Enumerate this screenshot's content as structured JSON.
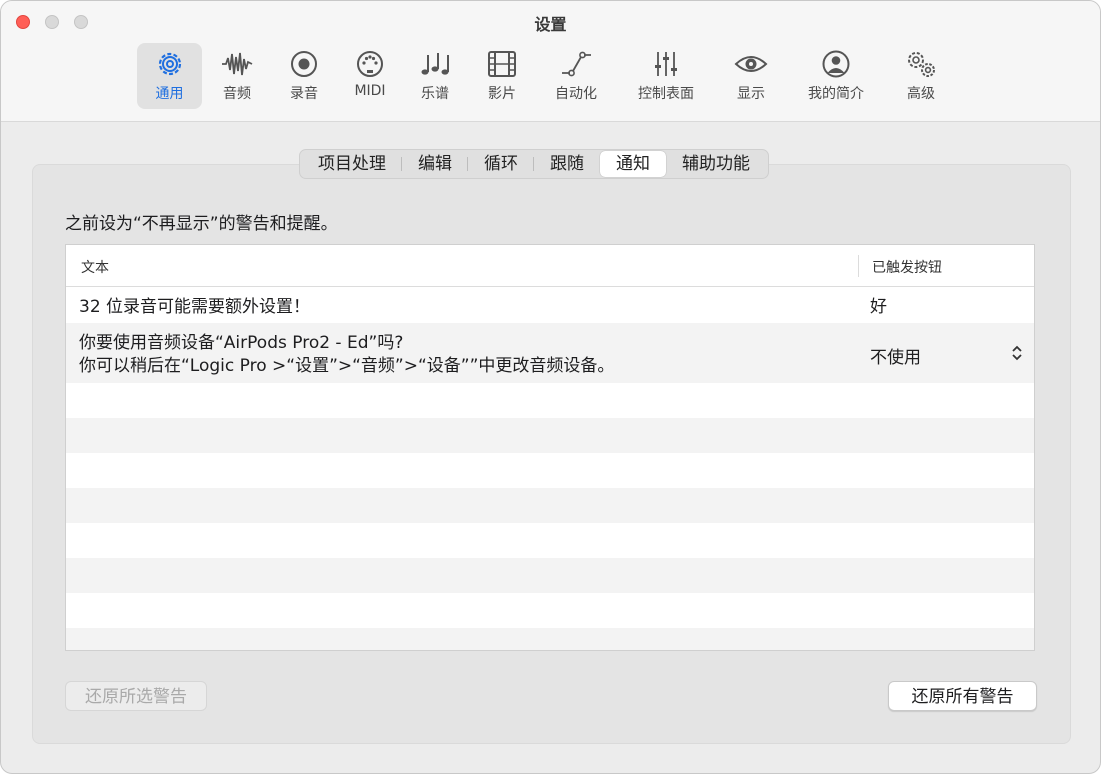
{
  "window": {
    "title": "设置"
  },
  "toolbar": {
    "items": [
      {
        "label": "通用",
        "icon": "gear-icon",
        "active": true
      },
      {
        "label": "音频",
        "icon": "waveform-icon"
      },
      {
        "label": "录音",
        "icon": "record-icon"
      },
      {
        "label": "MIDI",
        "icon": "midi-port-icon"
      },
      {
        "label": "乐谱",
        "icon": "music-notes-icon"
      },
      {
        "label": "影片",
        "icon": "film-strip-icon"
      },
      {
        "label": "自动化",
        "icon": "automation-curve-icon"
      },
      {
        "label": "控制表面",
        "icon": "faders-icon"
      },
      {
        "label": "显示",
        "icon": "eye-icon"
      },
      {
        "label": "我的简介",
        "icon": "person-icon"
      },
      {
        "label": "高级",
        "icon": "gears-icon"
      }
    ],
    "accent_color": "#1f6fe0"
  },
  "tabs": [
    {
      "label": "项目处理"
    },
    {
      "label": "编辑"
    },
    {
      "label": "循环"
    },
    {
      "label": "跟随"
    },
    {
      "label": "通知",
      "selected": true
    },
    {
      "label": "辅助功能"
    }
  ],
  "description": "之前设为“不再显示”的警告和提醒。",
  "table": {
    "columns": [
      "文本",
      "已触发按钮"
    ],
    "rows": [
      {
        "text": "32 位录音可能需要额外设置！",
        "button": "好"
      },
      {
        "text_line1": "你要使用音频设备“AirPods Pro2 - Ed”吗?",
        "text_line2": "你可以稍后在“Logic Pro >“设置”>“音频”>“设备””中更改音频设备。",
        "button": "不使用",
        "control": "popup-stepper"
      }
    ]
  },
  "buttons": {
    "restore_selected": "还原所选警告",
    "restore_all": "还原所有警告"
  }
}
